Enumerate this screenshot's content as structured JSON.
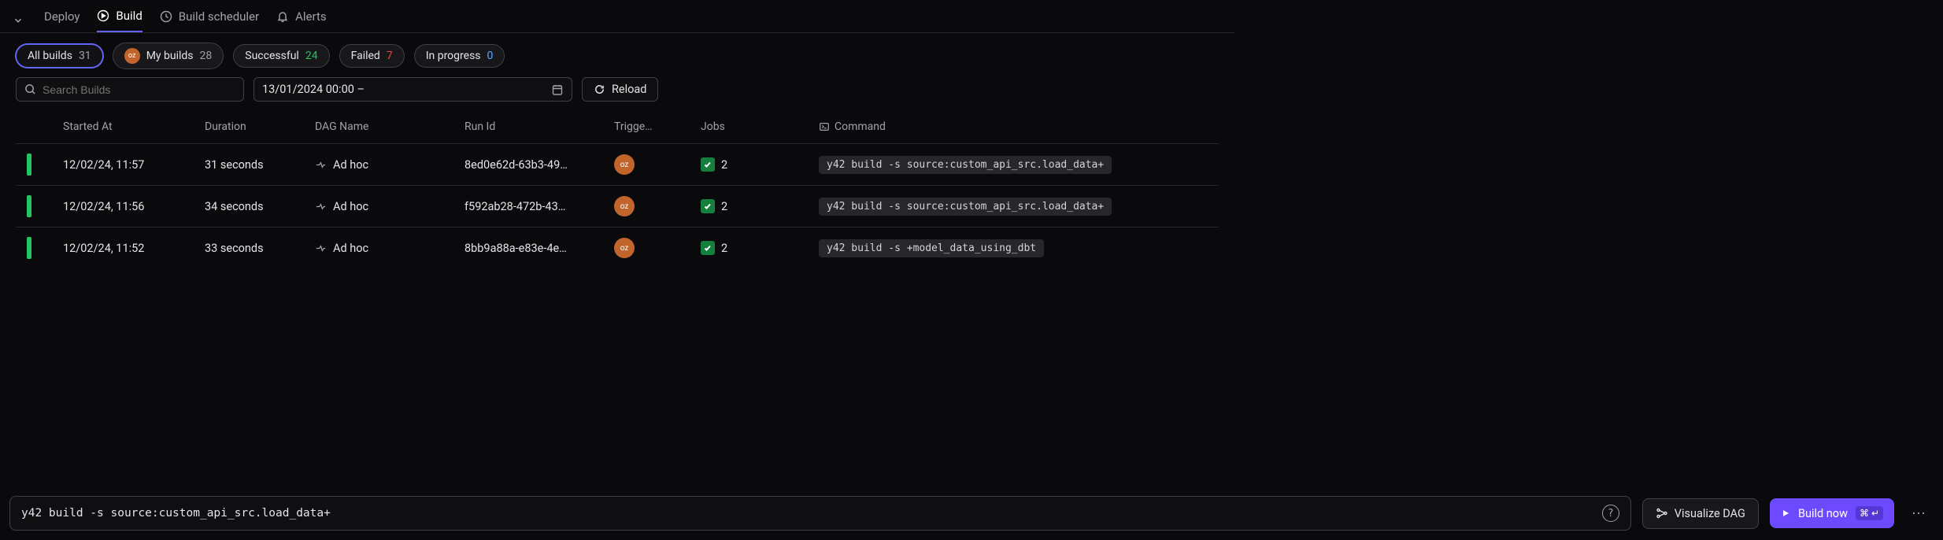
{
  "tabs": {
    "deploy": "Deploy",
    "build": "Build",
    "scheduler": "Build scheduler",
    "alerts": "Alerts"
  },
  "filters": {
    "all": {
      "label": "All builds",
      "count": "31"
    },
    "my": {
      "label": "My builds",
      "count": "28",
      "user": "oz"
    },
    "successful": {
      "label": "Successful",
      "count": "24"
    },
    "failed": {
      "label": "Failed",
      "count": "7"
    },
    "inprogress": {
      "label": "In progress",
      "count": "0"
    }
  },
  "search": {
    "placeholder": "Search Builds"
  },
  "date": {
    "value": "13/01/2024 00:00 –"
  },
  "reload": {
    "label": "Reload"
  },
  "columns": {
    "started": "Started At",
    "duration": "Duration",
    "dag": "DAG Name",
    "runid": "Run Id",
    "trigger": "Trigge…",
    "jobs": "Jobs",
    "command": "Command"
  },
  "rows": [
    {
      "started": "12/02/24, 11:57",
      "duration": "31 seconds",
      "dag": "Ad hoc",
      "runid": "8ed0e62d-63b3-49…",
      "user": "oz",
      "jobs": "2",
      "command": "y42 build -s source:custom_api_src.load_data+"
    },
    {
      "started": "12/02/24, 11:56",
      "duration": "34 seconds",
      "dag": "Ad hoc",
      "runid": "f592ab28-472b-43…",
      "user": "oz",
      "jobs": "2",
      "command": "y42 build -s source:custom_api_src.load_data+"
    },
    {
      "started": "12/02/24, 11:52",
      "duration": "33 seconds",
      "dag": "Ad hoc",
      "runid": "8bb9a88a-e83e-4e…",
      "user": "oz",
      "jobs": "2",
      "command": "y42 build -s +model_data_using_dbt"
    }
  ],
  "bottom": {
    "command": "y42 build -s source:custom_api_src.load_data+",
    "visualize": "Visualize DAG",
    "build_now": "Build now",
    "shortcut": "⌘ ↵"
  }
}
